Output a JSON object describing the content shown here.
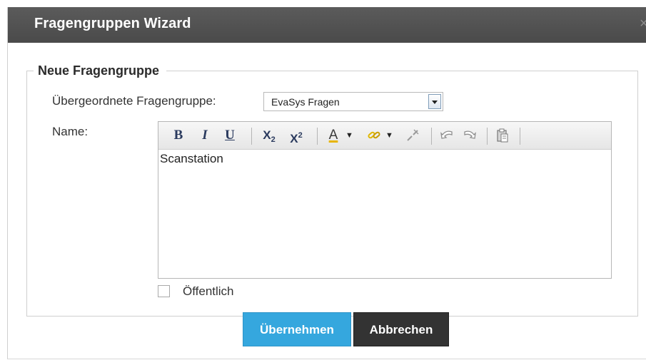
{
  "dialog": {
    "title": "Fragengruppen Wizard",
    "close_symbol": "×"
  },
  "group": {
    "legend": "Neue Fragengruppe",
    "parent_label": "Übergeordnete Fragengruppe:",
    "parent_value": "EvaSys Fragen",
    "name_label": "Name:",
    "name_value": "Scanstation",
    "public_label": "Öffentlich",
    "public_checked": false
  },
  "toolbar": {
    "bold": "B",
    "italic": "I",
    "underline": "U",
    "subscript": "X",
    "subscript_mark": "2",
    "superscript": "X",
    "superscript_mark": "2",
    "font_color": "A"
  },
  "buttons": {
    "apply": "Übernehmen",
    "cancel": "Abbrechen"
  },
  "colors": {
    "titlebar": "#4f4f4f",
    "primary": "#35a7de",
    "secondary": "#333333"
  }
}
